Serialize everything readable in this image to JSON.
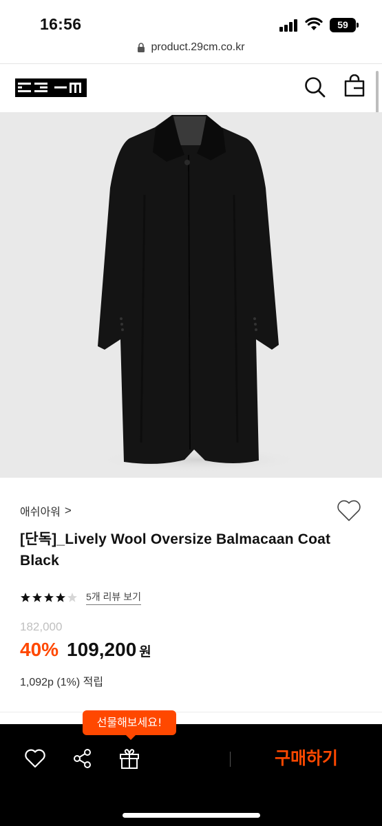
{
  "status_bar": {
    "time": "16:56",
    "battery": "59"
  },
  "browser": {
    "url": "product.29cm.co.kr"
  },
  "header": {
    "logo_icon": "29cm-logo",
    "search_icon": "search-icon",
    "bag_icon": "shopping-bag-icon"
  },
  "product": {
    "image_alt_icon": "coat-image",
    "brand": "애쉬아워",
    "brand_chevron": ">",
    "title": "[단독]_Lively Wool Oversize Balmacaan Coat Black",
    "rating": 4,
    "rating_max": 5,
    "review_link": "5개 리뷰 보기",
    "original_price": "182,000",
    "discount": "40%",
    "sale_price": "109,200",
    "currency": "원",
    "points": "1,092p (1%) 적립"
  },
  "bottom_bar": {
    "tooltip": "선물해보세요!",
    "like_icon": "heart-icon",
    "share_icon": "share-icon",
    "gift_icon": "gift-icon",
    "buy_label": "구매하기"
  },
  "colors": {
    "accent": "#ff4800",
    "bottom_bar_bg": "#000000",
    "image_bg": "#e9e9e9",
    "muted_text": "#c0c0c0"
  }
}
